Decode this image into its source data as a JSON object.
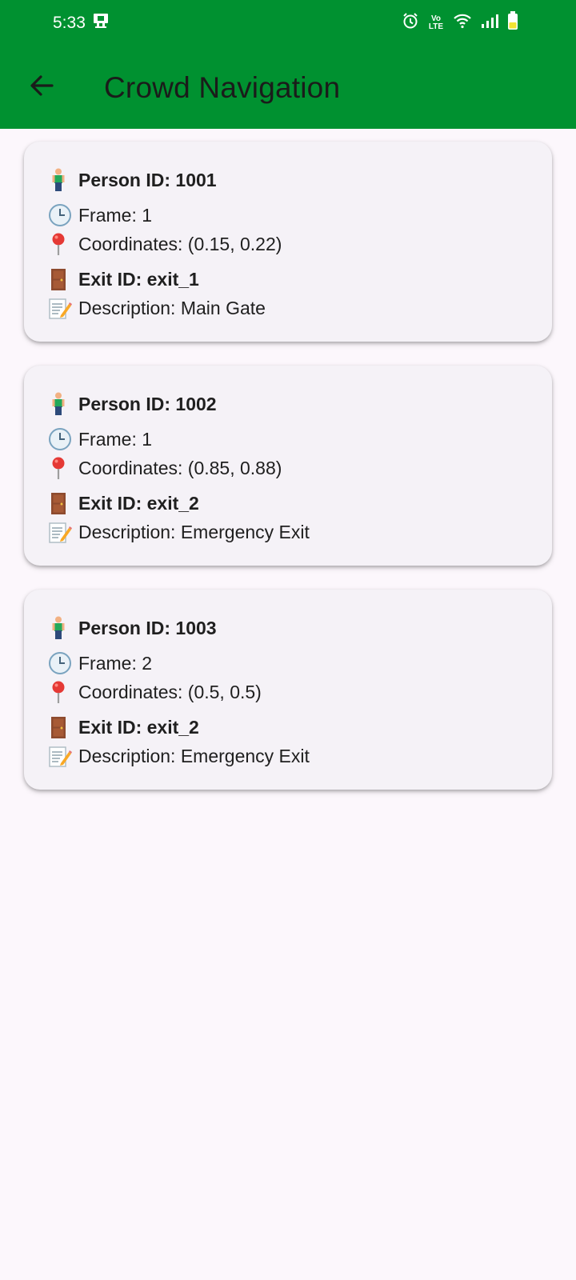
{
  "status_bar": {
    "time": "5:33",
    "network_label": "Vo LTE"
  },
  "app_bar": {
    "title": "Crowd Navigation",
    "back_icon": "arrow-back-icon"
  },
  "colors": {
    "app_bar": "#009130",
    "background": "#fcf7fc",
    "card": "#f5f2f7"
  },
  "people": [
    {
      "person_id": "Person ID: 1001",
      "frame": "Frame: 1",
      "coordinates": "Coordinates: (0.15, 0.22)",
      "exit_id": "Exit ID: exit_1",
      "description": "Description: Main Gate"
    },
    {
      "person_id": "Person ID: 1002",
      "frame": "Frame: 1",
      "coordinates": "Coordinates: (0.85, 0.88)",
      "exit_id": "Exit ID: exit_2",
      "description": "Description: Emergency Exit"
    },
    {
      "person_id": "Person ID: 1003",
      "frame": "Frame: 2",
      "coordinates": "Coordinates: (0.5, 0.5)",
      "exit_id": "Exit ID: exit_2",
      "description": "Description: Emergency Exit"
    }
  ]
}
